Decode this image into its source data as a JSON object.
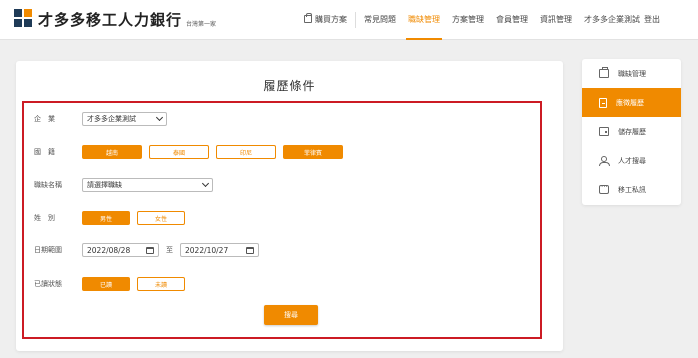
{
  "header": {
    "brand": "才多多移工人力銀行",
    "brand_sub": "台灣第一家",
    "nav": {
      "buy": "購買方案",
      "faq": "常見問題",
      "jobs": "職缺管理",
      "plans": "方案管理",
      "members": "會員管理",
      "info": "資訊管理",
      "account": "才多多企業測試",
      "logout": "登出"
    },
    "accent": "#f08a00"
  },
  "main": {
    "title": "履歷條件",
    "company": {
      "label": "企　業",
      "value": "才多多企業測試"
    },
    "nationality": {
      "label": "國　籍",
      "options": [
        "越南",
        "泰國",
        "印尼",
        "菲律賓"
      ],
      "selected": [
        "越南",
        "菲律賓"
      ]
    },
    "job": {
      "label": "職缺名稱",
      "placeholder": "請選擇職缺"
    },
    "gender": {
      "label": "姓　別",
      "options": [
        "男性",
        "女性"
      ],
      "selected": [
        "男性"
      ]
    },
    "date_range": {
      "label": "日期範圍",
      "from": "2022/08/28",
      "to_label": "至",
      "to": "2022/10/27"
    },
    "read_status": {
      "label": "已讀狀態",
      "options": [
        "已讀",
        "未讀"
      ],
      "selected": [
        "已讀"
      ]
    },
    "search_button": "搜尋"
  },
  "side_menu": {
    "items": [
      {
        "label": "職缺管理",
        "icon": "briefcase-icon",
        "active": false
      },
      {
        "label": "應徵履歷",
        "icon": "document-icon",
        "active": true
      },
      {
        "label": "儲存履歷",
        "icon": "wallet-icon",
        "active": false
      },
      {
        "label": "人才搜尋",
        "icon": "people-search-icon",
        "active": false
      },
      {
        "label": "移工私訊",
        "icon": "chat-icon",
        "active": false
      }
    ]
  }
}
